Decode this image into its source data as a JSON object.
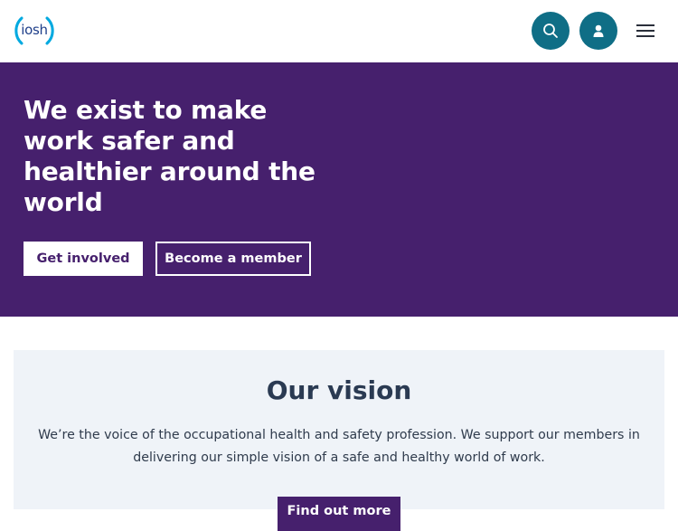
{
  "header": {
    "logo_text": "iosh",
    "search_icon": "search-icon",
    "account_icon": "user-icon",
    "menu_icon": "hamburger-menu-icon"
  },
  "hero": {
    "title": "We exist to make work safer and healthier around the world",
    "primary_button": "Get involved",
    "secondary_button": "Become a member"
  },
  "vision": {
    "title": "Our vision",
    "text": "We’re the voice of the occupational health and safety profession. We support our members in delivering our simple vision of a safe and healthy world of work.",
    "button": "Find out more"
  },
  "colors": {
    "brand_purple": "#46206d",
    "icon_teal": "#0f6e86",
    "vision_bg": "#eff3f8",
    "logo_cyan": "#00a9e0"
  }
}
